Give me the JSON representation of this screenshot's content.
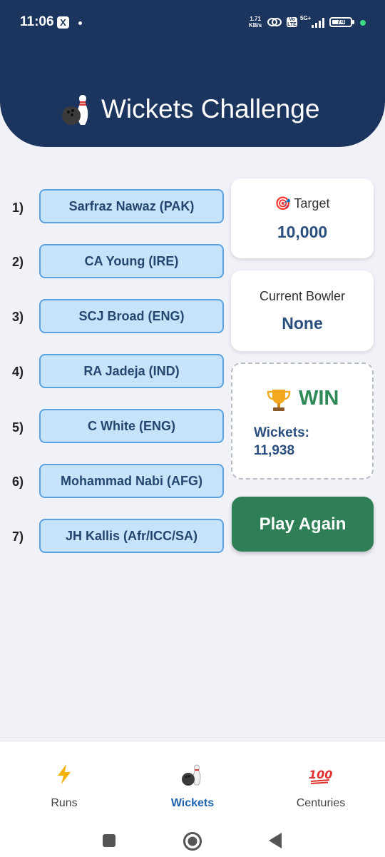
{
  "status_bar": {
    "time": "11:06",
    "x_icon": "X",
    "speed_value": "1.71",
    "speed_unit": "KB/s",
    "volte": "Vo LTE",
    "network": "5G+",
    "battery": "74"
  },
  "header": {
    "title": "Wickets Challenge",
    "icon": "bowling-icon"
  },
  "players": [
    {
      "num": "1)",
      "name": "Sarfraz Nawaz (PAK)"
    },
    {
      "num": "2)",
      "name": "CA Young (IRE)"
    },
    {
      "num": "3)",
      "name": "SCJ Broad (ENG)"
    },
    {
      "num": "4)",
      "name": "RA Jadeja (IND)"
    },
    {
      "num": "5)",
      "name": "C White (ENG)"
    },
    {
      "num": "6)",
      "name": "Mohammad Nabi (AFG)"
    },
    {
      "num": "7)",
      "name": "JH Kallis (Afr/ICC/SA)"
    }
  ],
  "target": {
    "icon": "🎯",
    "label": "Target",
    "value": "10,000"
  },
  "current_bowler": {
    "label": "Current Bowler",
    "value": "None"
  },
  "result": {
    "icon": "trophy-icon",
    "status": "WIN",
    "wickets_label": "Wickets:",
    "wickets_value": "11,938"
  },
  "play_again": "Play Again",
  "bottom_nav": [
    {
      "label": "Runs",
      "icon": "lightning-icon",
      "active": false
    },
    {
      "label": "Wickets",
      "icon": "bowling-icon",
      "active": true
    },
    {
      "label": "Centuries",
      "icon": "hundred-icon",
      "active": false
    }
  ],
  "colors": {
    "header": "#1c355e",
    "accent": "#2e7f56",
    "active_tab": "#1e63b0",
    "player_btn": "#c6e3fa"
  }
}
